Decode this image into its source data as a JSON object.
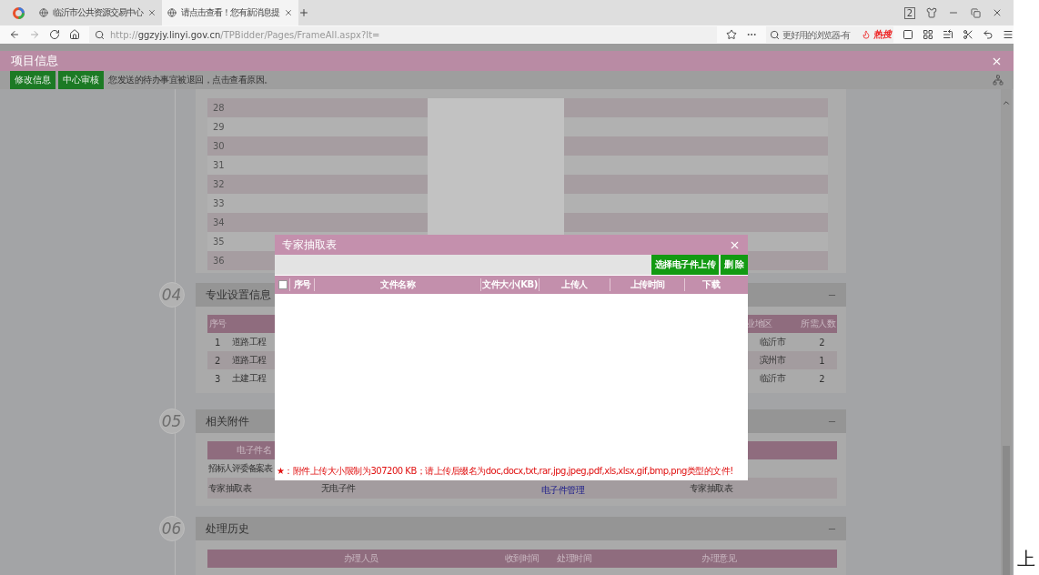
{
  "browser": {
    "tabs": [
      {
        "title": "临沂市公共资源交易中心",
        "selected": false
      },
      {
        "title": "请点击查看！您有新消息提",
        "selected": true
      }
    ],
    "address": "http://**ggzyjy.linyi.gov.cn**/TPBidder/Pages/FrameAll.aspx?It=",
    "search_placeholder": "更好用的浏览器-有",
    "hot_label": "热搜",
    "window_count": "2"
  },
  "page": {
    "title": "项目信息",
    "actions": [
      "修改信息",
      "中心审核"
    ],
    "notice": "您发送的待办事宜被退回，点击查看原因。"
  },
  "list_rows": [
    "28",
    "29",
    "30",
    "31",
    "32",
    "33",
    "34",
    "35",
    "36"
  ],
  "specialty": {
    "number": "04",
    "title": "专业设置信息",
    "columns": [
      "序号",
      "",
      "业地区",
      "所需人数"
    ],
    "rows": [
      {
        "cells": [
          "1",
          "道路工程",
          "临沂市",
          "2"
        ]
      },
      {
        "cells": [
          "2",
          "道路工程",
          "滨州市",
          "1"
        ]
      },
      {
        "cells": [
          "3",
          "土建工程",
          "临沂市",
          "2"
        ]
      }
    ]
  },
  "attachments": {
    "number": "05",
    "title": "相关附件",
    "header": "电子件名",
    "rows": [
      {
        "cells": [
          "招标人评委备案表"
        ]
      },
      {
        "cells": [
          "专家抽取表",
          "无电子件",
          "电子件管理",
          "专家抽取表"
        ]
      }
    ]
  },
  "history": {
    "number": "06",
    "title": "处理历史",
    "columns": [
      "办理人员",
      "收到时间",
      "处理时间",
      "办理意见"
    ]
  },
  "modal": {
    "title": "专家抽取表",
    "buttons": [
      "选择电子件上传",
      "删 除"
    ],
    "select_all_checked": false,
    "columns": [
      "序号",
      "文件名称",
      "文件大小(KB)",
      "上传人",
      "上传时间",
      "下载"
    ],
    "note_mark": "★",
    "note": "：附件上传大小限制为307200 KB；请上传后缀名为doc,docx,txt,rar,jpg,jpeg,pdf,xls,xlsx,gif,bmp,png类型的文件!"
  },
  "side_char": "上"
}
